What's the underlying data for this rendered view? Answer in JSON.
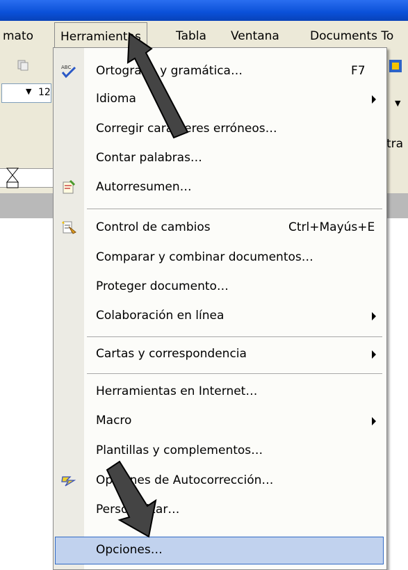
{
  "menubar": {
    "items": [
      "mato",
      "Herramientas",
      "Tabla",
      "Ventana",
      "Documents To"
    ]
  },
  "toolbar": {
    "font_size": "12",
    "right_fragment": "tra"
  },
  "menu": {
    "items": [
      {
        "label": "Ortografía y gramática…",
        "shortcut": "F7",
        "icon": "spellcheck-icon"
      },
      {
        "label": "Idioma",
        "submenu": true
      },
      {
        "label": "Corregir caracteres erróneos…"
      },
      {
        "label": "Contar palabras…"
      },
      {
        "label": "Autorresumen…",
        "icon": "autosummary-icon"
      },
      {
        "label": "Control de cambios",
        "shortcut": "Ctrl+Mayús+E",
        "icon": "track-changes-icon"
      },
      {
        "label": "Comparar y combinar documentos…"
      },
      {
        "label": "Proteger documento…"
      },
      {
        "label": "Colaboración en línea",
        "submenu": true
      },
      {
        "label": "Cartas y correspondencia",
        "submenu": true
      },
      {
        "label": "Herramientas en Internet…"
      },
      {
        "label": "Macro",
        "submenu": true
      },
      {
        "label": "Plantillas y complementos…"
      },
      {
        "label": "Opciones de Autocorrección…",
        "icon": "autocorrect-icon"
      },
      {
        "label": "Personalizar…"
      },
      {
        "label": "Opciones…",
        "highlighted": true
      }
    ]
  },
  "colors": {
    "highlight": "#c1d2ee",
    "highlight_border": "#316ac5",
    "menubar_bg": "#ece9d8",
    "title_blue": "#0a50d8"
  }
}
